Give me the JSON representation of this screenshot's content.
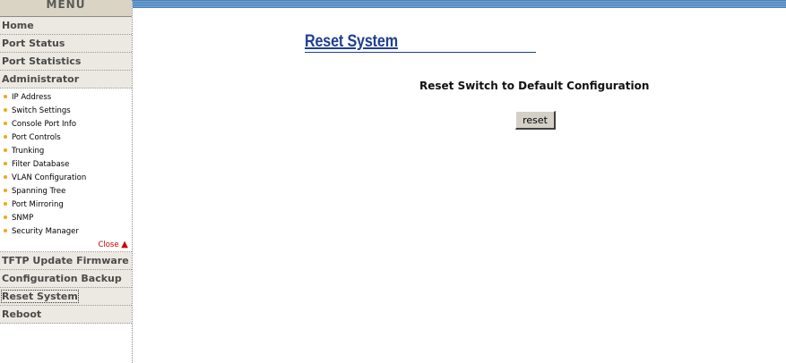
{
  "menu": {
    "title": "MENU",
    "top_items": [
      {
        "label": "Home"
      },
      {
        "label": "Port Status"
      },
      {
        "label": "Port Statistics"
      },
      {
        "label": "Administrator"
      }
    ],
    "admin_submenu": [
      {
        "label": "IP Address"
      },
      {
        "label": "Switch Settings"
      },
      {
        "label": "Console Port Info"
      },
      {
        "label": "Port Controls"
      },
      {
        "label": "Trunking"
      },
      {
        "label": "Filter Database"
      },
      {
        "label": "VLAN Configuration"
      },
      {
        "label": "Spanning Tree"
      },
      {
        "label": "Port Mirroring"
      },
      {
        "label": "SNMP"
      },
      {
        "label": "Security Manager"
      }
    ],
    "close_label": "Close",
    "bottom_items": [
      {
        "label": "TFTP Update Firmware"
      },
      {
        "label": "Configuration Backup"
      },
      {
        "label": "Reset System",
        "active": true
      },
      {
        "label": "Reboot"
      }
    ]
  },
  "main": {
    "title": "Reset System",
    "heading": "Reset Switch to Default Configuration",
    "reset_button": "reset"
  },
  "colors": {
    "title": "#1f3f8f",
    "menu_bg": "#ebe9e1",
    "bullet": "#f0a810",
    "close_text": "#cc0000",
    "top_bar": "#4a7fb8"
  }
}
